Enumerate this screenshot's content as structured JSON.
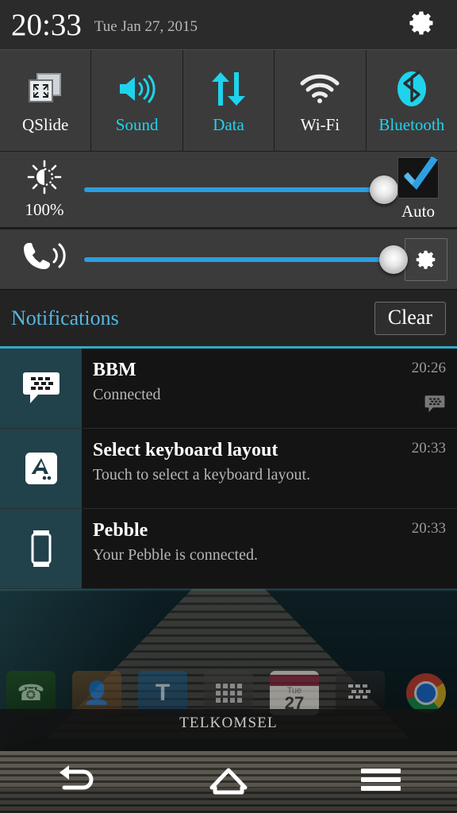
{
  "statusbar": {
    "time": "20:33",
    "date": "Tue Jan 27, 2015",
    "settings_icon": "gear-icon"
  },
  "quick_toggles": [
    {
      "label": "QSlide",
      "icon": "qslide-icon",
      "state": "off"
    },
    {
      "label": "Sound",
      "icon": "sound-icon",
      "state": "on"
    },
    {
      "label": "Data",
      "icon": "data-icon",
      "state": "on"
    },
    {
      "label": "Wi-Fi",
      "icon": "wifi-icon",
      "state": "off"
    },
    {
      "label": "Bluetooth",
      "icon": "bluetooth-icon",
      "state": "on"
    }
  ],
  "brightness": {
    "icon": "brightness-sun-icon",
    "percent": "100%",
    "value": 100,
    "auto_label": "Auto",
    "auto_checked": true
  },
  "volume": {
    "icon": "ringer-icon",
    "value": 100,
    "settings_icon": "gear-icon"
  },
  "notifications_panel": {
    "title": "Notifications",
    "clear_label": "Clear",
    "accent_color": "#35a9c4",
    "items": [
      {
        "icon": "bbm-icon",
        "title": "BBM",
        "text": "Connected",
        "time": "20:26",
        "badge": "bbm-badge-icon"
      },
      {
        "icon": "keyboard-layout-icon",
        "title": "Select keyboard layout",
        "text": "Touch to select a keyboard layout.",
        "time": "20:33",
        "badge": ""
      },
      {
        "icon": "pebble-watch-icon",
        "title": "Pebble",
        "text": "Your Pebble is connected.",
        "time": "20:33",
        "badge": ""
      }
    ]
  },
  "homescreen": {
    "carrier": "TELKOMSEL",
    "apps": [
      {
        "name": "phone-app-icon",
        "label": ""
      },
      {
        "name": "contacts-app-icon",
        "label": ""
      },
      {
        "name": "t-app-icon",
        "label": "T"
      },
      {
        "name": "app-drawer-icon",
        "label": ""
      },
      {
        "name": "calendar-app-icon",
        "label": "Tue",
        "day": "27"
      },
      {
        "name": "blackberry-app-icon",
        "label": ""
      },
      {
        "name": "chrome-app-icon",
        "label": ""
      }
    ]
  },
  "navbar": {
    "back": "back-icon",
    "home": "home-icon",
    "menu": "menu-icon"
  }
}
